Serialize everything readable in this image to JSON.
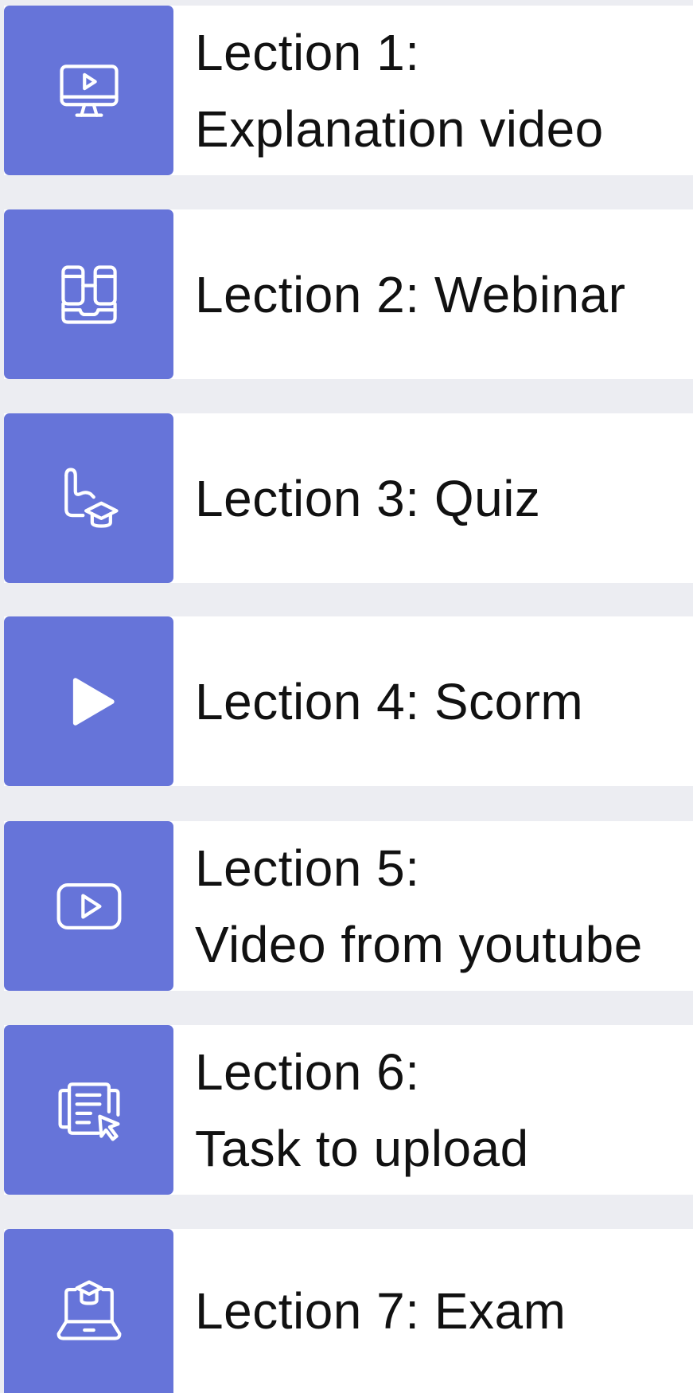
{
  "lessons": [
    {
      "icon": "monitor-play-icon",
      "lines": [
        "Lection 1:",
        "Explanation video"
      ]
    },
    {
      "icon": "webinar-icon",
      "lines": [
        "Lection 2: Webinar"
      ]
    },
    {
      "icon": "quiz-icon",
      "lines": [
        "Lection 3: Quiz"
      ]
    },
    {
      "icon": "play-icon",
      "lines": [
        "Lection 4: Scorm"
      ]
    },
    {
      "icon": "youtube-icon",
      "lines": [
        "Lection 5:",
        "Video from youtube"
      ]
    },
    {
      "icon": "task-upload-icon",
      "lines": [
        "Lection 6:",
        "Task to upload"
      ]
    },
    {
      "icon": "exam-laptop-icon",
      "lines": [
        "Lection 7: Exam"
      ]
    }
  ],
  "colors": {
    "page_background": "#ecedf2",
    "row_background": "#ffffff",
    "icon_tile": "#6674d9",
    "icon_stroke": "#ffffff",
    "label_text": "#111111"
  }
}
